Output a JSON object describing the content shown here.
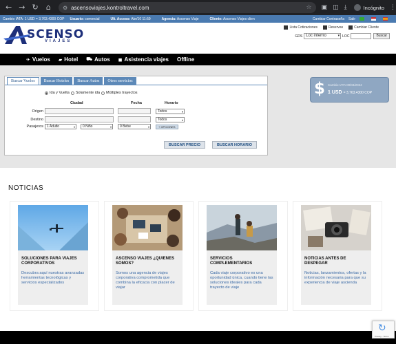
{
  "browser": {
    "url": "ascensoviajes.kontroltravel.com",
    "profile": "Incógnito"
  },
  "info_bar": {
    "rate": "Cambio IATA: 1 USD = 3,763.4300 COP",
    "user_label": "Usuario:",
    "user_value": "comercial",
    "last_access_label": "Ult. Acceso:",
    "last_access_value": "Abr/10 11:59",
    "agency_label": "Agencia:",
    "agency_value": "Ascenso Viaje",
    "client_label": "Cliente:",
    "client_value": "Ascenso Viajes clien",
    "change_password": "Cambiar Contraseña",
    "exit": "Salir",
    "colors": {
      "bar": "#4a7ab0"
    }
  },
  "header": {
    "logo_main": "SCENSO",
    "logo_sub": "VIAJES",
    "links": [
      "Lista Cotizaciones",
      "Reservas",
      "Cambiar Cliente"
    ],
    "gds_label": "GDS",
    "gds_value": "Loc interno",
    "loc_label": "LOC",
    "search_button": "Buscar"
  },
  "nav": {
    "items": [
      {
        "label": "Vuelos",
        "icon": "plane-icon"
      },
      {
        "label": "Hotel",
        "icon": "bed-icon"
      },
      {
        "label": "Autos",
        "icon": "car-icon"
      },
      {
        "label": "Asistencia viajes",
        "icon": "briefcase-icon"
      },
      {
        "label": "Offline",
        "icon": ""
      }
    ]
  },
  "search": {
    "tabs": [
      "Buscar Vuelos",
      "Buscar Hoteles",
      "Buscar Autos",
      "Otros servicios"
    ],
    "trip_types": [
      "Ida y Vuelta",
      "Solamente ida",
      "Múltiples trayectos"
    ],
    "headers": {
      "city": "Ciudad",
      "date": "Fecha",
      "schedule": "Horario"
    },
    "labels": {
      "origin": "Origen",
      "destination": "Destino",
      "passengers": "Pasajeros"
    },
    "schedule_origin": "Todos",
    "schedule_destination": "Todos",
    "adults": "1 Adulto",
    "children": "0 Niño",
    "babies": "0 Bebe",
    "options_button": "+ OPCIONES",
    "search_price_button": "BUSCAR PRECIO",
    "search_schedule_button": "BUSCAR HORARIO"
  },
  "exchange": {
    "symbol": "$",
    "title": "Cambio IATA 09/04/2024",
    "rate_main": "1 USD",
    "rate_detail": "= 3,763.4300 COP"
  },
  "news": {
    "title": "NOTICIAS",
    "cards": [
      {
        "title": "SOLUCIONES PARA VIAJES CORPORATIVOS",
        "desc": "Descubra aquí nuestras avanzadas herramientas tecnológicas y servicios especializados"
      },
      {
        "title": "ASCENSO VIAJES ¿QUIENES SOMOS?",
        "desc": "Somos una agencia de viajes corporativa comprometida que combina la eficacia con placer de viajar"
      },
      {
        "title": "SERVICIOS COMPLEMENTARIOS",
        "desc": "Cada viaje corporativo es una oportunidad única, cuando tiene las soluciones ideales para cada trayecto de viaje"
      },
      {
        "title": "NOTICIAS ANTES DE DESPEGAR",
        "desc": "Noticias, lanzamientos, ofertas y la información necesaria para que su experiencia de viaje ascienda"
      }
    ]
  },
  "recaptcha": {
    "text": "Privacy - Terms"
  }
}
